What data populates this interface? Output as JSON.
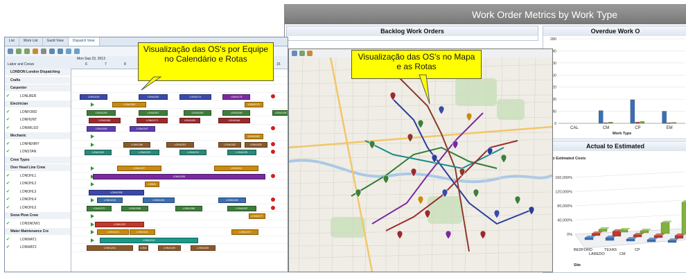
{
  "metrics": {
    "title": "Work Order Metrics by Work Type",
    "backlog": {
      "title": "Backlog Work Orders"
    },
    "overdue": {
      "title": "Overdue Work O"
    },
    "actual": {
      "title": "Actual to Estimated",
      "ylabel": "ual to Estimated Costs",
      "zlabel": "Site"
    }
  },
  "chart_data": [
    {
      "type": "bar",
      "title": "Overdue Work O",
      "categories": [
        "CAL",
        "CM",
        "CP",
        "EM"
      ],
      "xlabel": "Work Type",
      "ylabel": "",
      "ylim": [
        0,
        280
      ],
      "yticks": [
        0,
        40,
        80,
        120,
        160,
        200,
        240,
        280
      ],
      "series": [
        {
          "values": [
            0,
            42,
            78,
            40
          ],
          "color": "#3a6fb6"
        },
        {
          "values": [
            0,
            2,
            4,
            2
          ],
          "color": "#c0392b"
        },
        {
          "values": [
            0,
            4,
            6,
            3
          ],
          "color": "#7fb33a"
        }
      ],
      "grid": true
    },
    {
      "type": "bar",
      "title": "Actual to Estimated",
      "ylabel": "ual to Estimated Costs",
      "xlabel": "Site",
      "categories": [
        "BEDFORD",
        "LAREDO",
        "TEXAS",
        "CM",
        "CP"
      ],
      "ylim": [
        0,
        160000
      ],
      "yticks": [
        "0%",
        "40,000%",
        "80,000%",
        "120,000%",
        "160,000%"
      ],
      "series": [
        {
          "values": [
            5000,
            8000,
            4000,
            6000,
            5000
          ],
          "color": "#3a6fb6"
        },
        {
          "values": [
            4000,
            14000,
            5000,
            6000,
            8000
          ],
          "color": "#c0392b"
        },
        {
          "values": [
            0,
            0,
            0,
            30000,
            90000
          ],
          "color": "#7fb33a"
        }
      ]
    }
  ],
  "dispatch": {
    "tabs": [
      "List",
      "Work List",
      "Gantt View",
      "Dispatch View"
    ],
    "active_tab": "Dispatch View",
    "labor_header": "Labor and Crews",
    "date": "Mon Sep 23, 2013",
    "days": [
      "6",
      "7",
      "8",
      "15"
    ],
    "rows": [
      {
        "label": "LONDON  London Dispatching",
        "type": "hdr"
      },
      {
        "label": "Crafts",
        "type": "hdr"
      },
      {
        "label": "Carpenter",
        "type": "hdr"
      },
      {
        "label": "LONLBER",
        "checked": true
      },
      {
        "label": "Electrician",
        "type": "hdr"
      },
      {
        "label": "LONFORD",
        "checked": true
      },
      {
        "label": "LONHUNT",
        "checked": true
      },
      {
        "label": "LONWILSO",
        "checked": true
      },
      {
        "label": "Mechanic",
        "type": "hdr"
      },
      {
        "label": "LONHENRY",
        "checked": true
      },
      {
        "label": "LONSTAN",
        "checked": true
      },
      {
        "label": "Crew Types",
        "type": "hdr"
      },
      {
        "label": "Over Head Line Crew",
        "type": "hdr"
      },
      {
        "label": "LONOHL1",
        "checked": true
      },
      {
        "label": "LONOHL2",
        "checked": true
      },
      {
        "label": "LONOHL3",
        "checked": true
      },
      {
        "label": "LONOHL4",
        "checked": true
      },
      {
        "label": "LONOHL5",
        "checked": true
      },
      {
        "label": "Snow Plow Crew",
        "type": "hdr"
      },
      {
        "label": "LONSNOW1",
        "checked": true
      },
      {
        "label": "Water Maintenance Cre",
        "type": "hdr"
      },
      {
        "label": "LONWAT1",
        "checked": true
      },
      {
        "label": "LONWAT2",
        "checked": true
      }
    ],
    "bars": [
      {
        "row": 3,
        "items": [
          {
            "label": "LON41150",
            "color": "#3b4aa8",
            "start": 0.04,
            "end": 0.16
          },
          {
            "label": "LON41160",
            "color": "#3b4aa8",
            "start": 0.31,
            "end": 0.44
          },
          {
            "label": "LON41174",
            "color": "#3b4aa8",
            "start": 0.5,
            "end": 0.64
          },
          {
            "label": "LON41175",
            "color": "#7a2aa0",
            "start": 0.7,
            "end": 0.82
          }
        ]
      },
      {
        "row": 4,
        "items": [
          {
            "label": "LON41183",
            "color": "#c98a10",
            "start": 0.19,
            "end": 0.34
          },
          {
            "label": "LON41175",
            "color": "#c98a10",
            "start": 0.8,
            "end": 0.88
          }
        ]
      },
      {
        "row": 5,
        "items": [
          {
            "label": "LON41200",
            "color": "#3d7f3a",
            "start": 0.07,
            "end": 0.2
          },
          {
            "label": "LON41187",
            "color": "#3d7f3a",
            "start": 0.31,
            "end": 0.44
          },
          {
            "label": "LON41190",
            "color": "#3d7f3a",
            "start": 0.52,
            "end": 0.64
          },
          {
            "label": "LON41166",
            "color": "#3d7f3a",
            "start": 0.7,
            "end": 0.82
          },
          {
            "label": "LON41198",
            "color": "#3d7f3a",
            "start": 0.93,
            "end": 1.0
          }
        ]
      },
      {
        "row": 6,
        "items": [
          {
            "label": "LON41165",
            "color": "#9b2b2b",
            "start": 0.08,
            "end": 0.22
          },
          {
            "label": "LON41172",
            "color": "#9b2b2b",
            "start": 0.3,
            "end": 0.44
          },
          {
            "label": "LON41181",
            "color": "#9b2b2b",
            "start": 0.5,
            "end": 0.59
          },
          {
            "label": "LON41166",
            "color": "#9b2b2b",
            "start": 0.68,
            "end": 0.82
          }
        ]
      },
      {
        "row": 7,
        "items": [
          {
            "label": "LON41169",
            "color": "#5c3fb0",
            "start": 0.07,
            "end": 0.2
          },
          {
            "label": "LON41167",
            "color": "#5c3fb0",
            "start": 0.27,
            "end": 0.38
          }
        ]
      },
      {
        "row": 8,
        "items": [
          {
            "label": "LON41182",
            "color": "#c98a10",
            "start": 0.8,
            "end": 0.88
          }
        ]
      },
      {
        "row": 9,
        "items": [
          {
            "label": "LON41166",
            "color": "#8b5a2b",
            "start": 0.24,
            "end": 0.36
          },
          {
            "label": "LON41191",
            "color": "#8b5a2b",
            "start": 0.44,
            "end": 0.56
          },
          {
            "label": "LON41182",
            "color": "#8b5a2b",
            "start": 0.68,
            "end": 0.78
          },
          {
            "label": "LON41183",
            "color": "#8b5a2b",
            "start": 0.8,
            "end": 0.9
          }
        ]
      },
      {
        "row": 10,
        "items": [
          {
            "label": "LON41200",
            "color": "#2a8a7a",
            "start": 0.06,
            "end": 0.18
          },
          {
            "label": "LON41223",
            "color": "#2a8a7a",
            "start": 0.27,
            "end": 0.4
          },
          {
            "label": "LON41211",
            "color": "#2a8a7a",
            "start": 0.5,
            "end": 0.62
          },
          {
            "label": "LON41225",
            "color": "#2a8a7a",
            "start": 0.72,
            "end": 0.85
          }
        ]
      },
      {
        "row": 12,
        "items": [
          {
            "label": "LON41207",
            "color": "#c98a10",
            "start": 0.21,
            "end": 0.41
          },
          {
            "label": "LON41211",
            "color": "#c98a10",
            "start": 0.66,
            "end": 0.86
          }
        ]
      },
      {
        "row": 13,
        "items": [
          {
            "label": "LON41208",
            "color": "#7a2aa0",
            "start": 0.1,
            "end": 0.89
          }
        ]
      },
      {
        "row": 14,
        "items": [
          {
            "label": "LON41",
            "color": "#c98a10",
            "start": 0.34,
            "end": 0.4
          }
        ]
      },
      {
        "row": 15,
        "items": [
          {
            "label": "LON41208",
            "color": "#3b4aa8",
            "start": 0.08,
            "end": 0.33
          }
        ]
      },
      {
        "row": 16,
        "items": [
          {
            "label": "LON41215",
            "color": "#3b6fb0",
            "start": 0.12,
            "end": 0.23
          },
          {
            "label": "LON41216",
            "color": "#3b6fb0",
            "start": 0.33,
            "end": 0.47
          },
          {
            "label": "LON41226",
            "color": "#3b6fb0",
            "start": 0.68,
            "end": 0.8
          }
        ]
      },
      {
        "row": 17,
        "items": [
          {
            "label": "LON41270",
            "color": "#3d7f3a",
            "start": 0.07,
            "end": 0.18
          },
          {
            "label": "LON41266",
            "color": "#3d7f3a",
            "start": 0.23,
            "end": 0.35
          },
          {
            "label": "LON41268",
            "color": "#3d7f3a",
            "start": 0.48,
            "end": 0.6
          },
          {
            "label": "LON41267",
            "color": "#3d7f3a",
            "start": 0.72,
            "end": 0.85
          }
        ]
      },
      {
        "row": 18,
        "items": [
          {
            "label": "LON41177",
            "color": "#c98a10",
            "start": 0.82,
            "end": 0.89
          }
        ]
      },
      {
        "row": 19,
        "items": [
          {
            "label": "LON41222",
            "color": "#c0392b",
            "start": 0.11,
            "end": 0.33
          }
        ]
      },
      {
        "row": 20,
        "items": [
          {
            "label": "LON41213",
            "color": "#c98a10",
            "start": 0.12,
            "end": 0.26
          },
          {
            "label": "LON41161",
            "color": "#c98a10",
            "start": 0.27,
            "end": 0.38
          },
          {
            "label": "LON41227",
            "color": "#c98a10",
            "start": 0.74,
            "end": 0.86
          }
        ]
      },
      {
        "row": 21,
        "items": [
          {
            "label": "LON41210",
            "color": "#1a9a8a",
            "start": 0.13,
            "end": 0.58
          }
        ]
      },
      {
        "row": 22,
        "items": [
          {
            "label": "LON41201",
            "color": "#8b5a2b",
            "start": 0.07,
            "end": 0.28
          },
          {
            "label": "LON4",
            "color": "#8b5a2b",
            "start": 0.31,
            "end": 0.35
          },
          {
            "label": "LON41199",
            "color": "#8b5a2b",
            "start": 0.4,
            "end": 0.5
          },
          {
            "label": "LON41200",
            "color": "#8b5a2b",
            "start": 0.55,
            "end": 0.66
          }
        ]
      }
    ]
  },
  "callouts": {
    "team": "Visualização das OS's por Equipe no Calendário e Rotas",
    "map": "Visualização das OS's no Mapa e as Rotas"
  }
}
